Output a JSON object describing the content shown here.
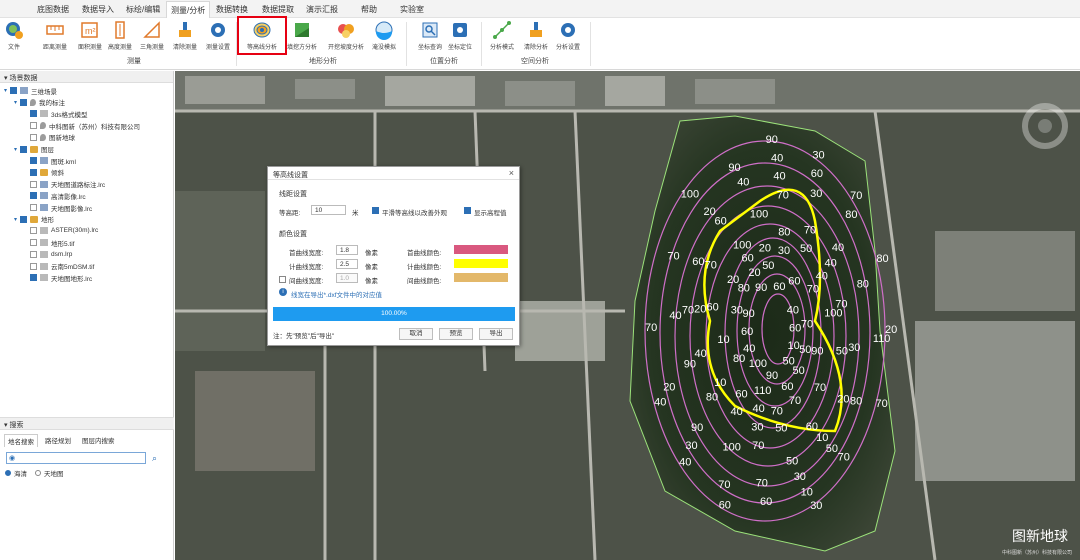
{
  "menu": {
    "items": [
      "底图数据",
      "数据导入",
      "标绘/编辑",
      "测量/分析",
      "数据转换",
      "数据提取",
      "演示汇报",
      "帮助",
      "实验室"
    ],
    "active": "测量/分析"
  },
  "ribbon": {
    "file_label": "文件",
    "measure": {
      "group": "测量",
      "buttons": [
        "距离测量",
        "面积测量",
        "高度测量",
        "三角测量",
        "清除测量",
        "测量设置"
      ]
    },
    "terrain": {
      "group": "地形分析",
      "buttons": [
        "等高线分析",
        "填挖方分析",
        "开挖坡度分析",
        "淹没模拟"
      ]
    },
    "position": {
      "group": "位置分析",
      "buttons": [
        "坐标查询",
        "坐标定位"
      ]
    },
    "space": {
      "group": "空间分析",
      "buttons": [
        "分析模式",
        "清除分析",
        "分析设置"
      ]
    }
  },
  "scene_panel": {
    "title": "场景数据",
    "tree": [
      {
        "label": "三维场景",
        "level": 0,
        "icon": "globe-icon",
        "checked": true
      },
      {
        "label": "我的标注",
        "level": 1,
        "icon": "pin-icon",
        "checked": true
      },
      {
        "label": "3ds格式模型",
        "level": 2,
        "icon": "file-icon",
        "checked": true
      },
      {
        "label": "中科图新（苏州）科技有限公司",
        "level": 2,
        "icon": "pin-icon",
        "checked": false
      },
      {
        "label": "图新地球",
        "level": 2,
        "icon": "pin-icon",
        "checked": false
      },
      {
        "label": "图层",
        "level": 1,
        "icon": "folder-icon",
        "checked": true
      },
      {
        "label": "图斑.kml",
        "level": 2,
        "icon": "layer-icon",
        "checked": true
      },
      {
        "label": "倾斜",
        "level": 2,
        "icon": "folder-icon",
        "checked": true
      },
      {
        "label": "天地图道路标注.lrc",
        "level": 2,
        "icon": "layer-icon",
        "checked": false
      },
      {
        "label": "高清影像.lrc",
        "level": 2,
        "icon": "layer-icon",
        "checked": true
      },
      {
        "label": "天地图影像.lrc",
        "level": 2,
        "icon": "layer-icon",
        "checked": false
      },
      {
        "label": "地形",
        "level": 1,
        "icon": "folder-icon",
        "checked": true
      },
      {
        "label": "ASTER(30m).lrc",
        "level": 2,
        "icon": "file-icon",
        "checked": false
      },
      {
        "label": "地形5.tif",
        "level": 2,
        "icon": "file-icon",
        "checked": false
      },
      {
        "label": "dsm.lrp",
        "level": 2,
        "icon": "file-icon",
        "checked": false
      },
      {
        "label": "云南5mDSM.tif",
        "level": 2,
        "icon": "file-icon",
        "checked": false
      },
      {
        "label": "天地图地形.lrc",
        "level": 2,
        "icon": "file-icon",
        "checked": true
      }
    ]
  },
  "search_panel": {
    "title": "搜索",
    "tabs": [
      "地名搜索",
      "路径规划",
      "图层内搜索"
    ],
    "active_tab": "地名搜索",
    "input_value": "",
    "options": [
      "海清",
      "天地图"
    ],
    "selected_option": "海清"
  },
  "dialog": {
    "title": "等高线设置",
    "section_spacing": "线距设置",
    "interval_label": "等高距:",
    "interval_value": "10",
    "interval_unit": "米",
    "smooth_label": "平滑等高线以改善外观",
    "smooth_checked": true,
    "show_elev_label": "显示高程值",
    "show_elev_checked": true,
    "section_color": "颜色设置",
    "rows": [
      {
        "width_label": "首曲线宽度:",
        "width_value": "1.8",
        "unit": "像素",
        "color_label": "首曲线颜色:",
        "color": "#d9587f",
        "enabled": true
      },
      {
        "width_label": "计曲线宽度:",
        "width_value": "2.5",
        "unit": "像素",
        "color_label": "计曲线颜色:",
        "color": "#ffff00",
        "enabled": true
      },
      {
        "width_label": "间曲线宽度:",
        "width_value": "1.0",
        "unit": "像素",
        "color_label": "间曲线颜色:",
        "color": "#e3b86a",
        "enabled": false
      }
    ],
    "info_text": "线宽在导出*.dxf文件中的对应值",
    "progress_text": "100.00%",
    "progress_value": 1.0,
    "note": "注：先\"预览\"后\"导出\"",
    "buttons": {
      "cancel": "取消",
      "preview": "预览",
      "export": "导出"
    }
  },
  "watermark": {
    "brand": "图新地球",
    "company": "中科图新（苏州）科技有限公司"
  },
  "contour_labels": [
    "20",
    "30",
    "40",
    "10",
    "20",
    "40",
    "40",
    "20",
    "10",
    "40",
    "60",
    "30",
    "60",
    "70",
    "40",
    "20",
    "50",
    "60",
    "70",
    "60",
    "20",
    "30",
    "80",
    "80",
    "70",
    "30",
    "40",
    "60",
    "90",
    "80",
    "90",
    "70",
    "50",
    "20",
    "70",
    "100",
    "90",
    "70",
    "40",
    "40",
    "70",
    "100",
    "90",
    "80",
    "60",
    "30",
    "70",
    "80",
    "100",
    "100",
    "70",
    "10",
    "60",
    "90",
    "100",
    "110",
    "90",
    "70",
    "60",
    "60",
    "70",
    "110",
    "90",
    "70",
    "20",
    "30",
    "50",
    "70",
    "100",
    "60",
    "50",
    "50",
    "70",
    "80",
    "70",
    "60",
    "50",
    "10",
    "30",
    "60",
    "90",
    "80",
    "70",
    "40",
    "20",
    "40",
    "50",
    "70",
    "80",
    "60",
    "40",
    "40",
    "50",
    "70",
    "40",
    "30",
    "60",
    "50",
    "40",
    "30",
    "10"
  ]
}
